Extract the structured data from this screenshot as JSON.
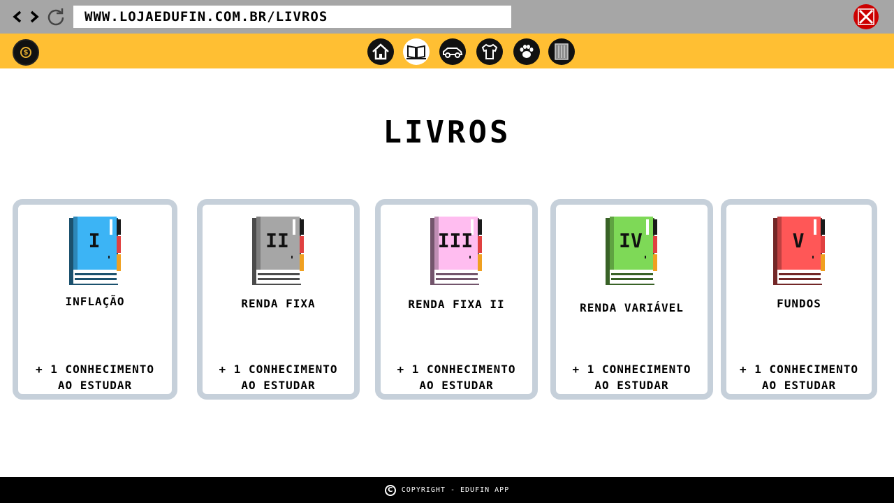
{
  "browser": {
    "url": "WWW.LOJAEDUFIN.COM.BR/LIVROS"
  },
  "header": {
    "categories": [
      "home-icon",
      "book-icon",
      "car-icon",
      "shirt-icon",
      "paw-icon",
      "building-icon"
    ],
    "active_category": "book-icon",
    "accent_color": "#ffbf33"
  },
  "page": {
    "title": "LIVROS"
  },
  "books": [
    {
      "numeral": "I",
      "title": "INFLAÇÃO",
      "reward_line1": "+ 1 CONHECIMENTO",
      "reward_line2": "AO ESTUDAR",
      "color": "#3cb4f5"
    },
    {
      "numeral": "II",
      "title": "RENDA FIXA",
      "reward_line1": "+ 1 CONHECIMENTO",
      "reward_line2": "AO ESTUDAR",
      "color": "#a6a6a6"
    },
    {
      "numeral": "III",
      "title": "RENDA FIXA II",
      "reward_line1": "+ 1 CONHECIMENTO",
      "reward_line2": "AO ESTUDAR",
      "color": "#ffbdf0"
    },
    {
      "numeral": "IV",
      "title": "RENDA VARIÁVEL",
      "reward_line1": "+ 1 CONHECIMENTO",
      "reward_line2": "AO ESTUDAR",
      "color": "#7ed957"
    },
    {
      "numeral": "V",
      "title": "FUNDOS",
      "reward_line1": "+ 1 CONHECIMENTO",
      "reward_line2": "AO ESTUDAR",
      "color": "#ff5757"
    }
  ],
  "footer": {
    "copyright_symbol": "C",
    "text": "COPYRIGHT - EDUFIN APP"
  }
}
